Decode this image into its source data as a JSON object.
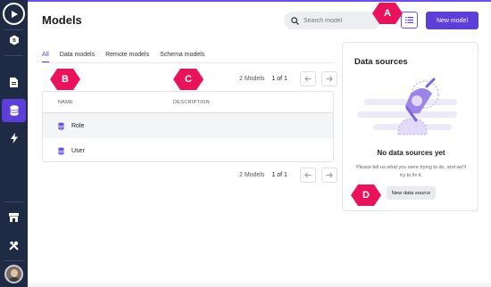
{
  "header": {
    "title": "Models",
    "search_placeholder": "Search model",
    "new_model_label": "New model"
  },
  "tabs": [
    {
      "label": "All",
      "active": true
    },
    {
      "label": "Data models",
      "active": false
    },
    {
      "label": "Remote models",
      "active": false
    },
    {
      "label": "Schema models",
      "active": false
    }
  ],
  "pagination": {
    "count_label": "2 Models",
    "page_label": "1 of 1"
  },
  "table": {
    "columns": [
      "NAME",
      "DESCRIPTION"
    ],
    "rows": [
      {
        "name": "Role",
        "description": ""
      },
      {
        "name": "User",
        "description": ""
      }
    ]
  },
  "data_sources": {
    "title": "Data sources",
    "empty_title": "No data sources yet",
    "empty_message": "Please tell us what you were trying to do, and we'll try to fix it.",
    "new_button_label": "New data source"
  },
  "callouts": [
    "A",
    "B",
    "C",
    "D"
  ],
  "colors": {
    "accent": "#5b3fd8",
    "sidebar": "#1f2a44",
    "callout": "#e8135a"
  }
}
